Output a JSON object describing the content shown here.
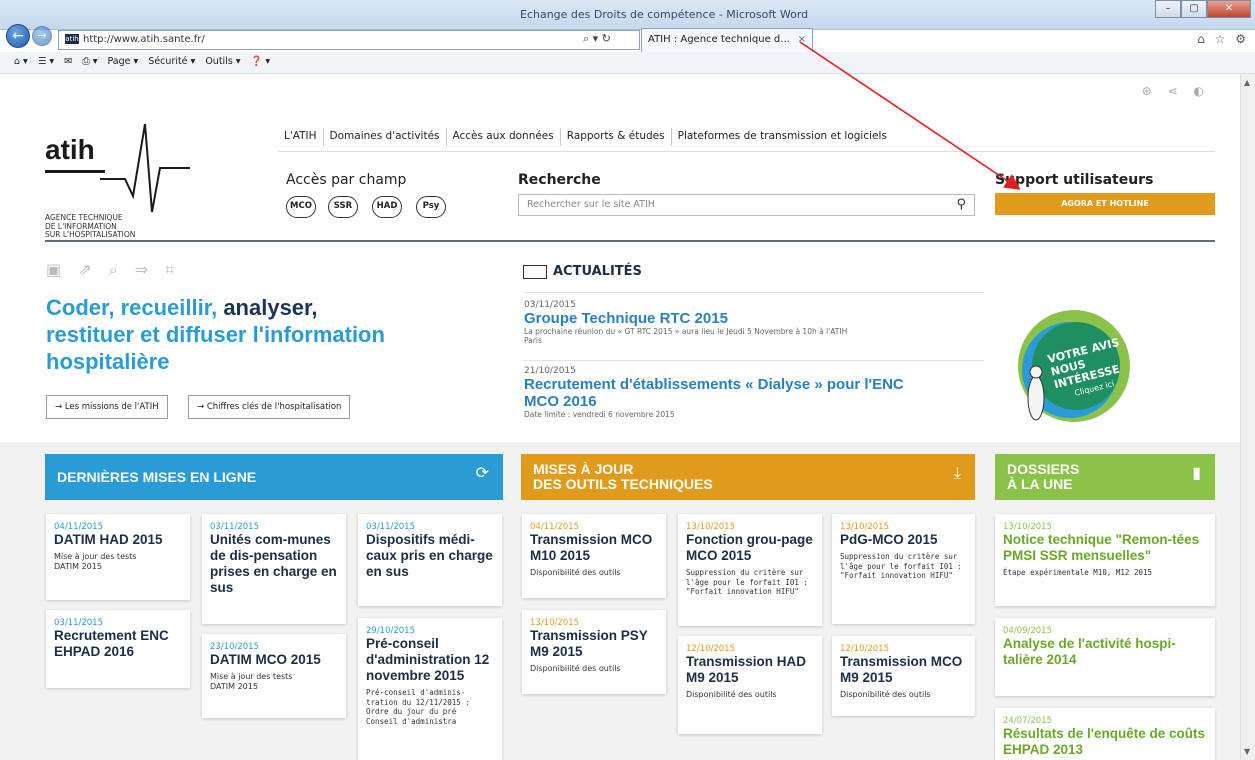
{
  "browser": {
    "window_title": "Echange des Droits de compétence - Microsoft Word",
    "back_glyph": "←",
    "forward_glyph": "→",
    "address": "http://www.atih.sante.fr/",
    "address_icon_text": "atih",
    "addr_tools": "⌕ ▾ ↻",
    "tab_label": "ATIH : Agence technique d...",
    "tab_close": "×",
    "right_icons": "⌂ ☆ ⚙",
    "win_min": "–",
    "win_max": "▢",
    "win_close": "✕",
    "cmd_items": [
      "⌂ ▾",
      "☰ ▾",
      "✉",
      "⎙ ▾",
      "Page ▾",
      "Sécurité ▾",
      "Outils ▾",
      "❓ ▾"
    ]
  },
  "site": {
    "top_icons": "⊛ ⋖ ◐",
    "logo_text": "atih",
    "logo_tagline": "AGENCE TECHNIQUE\nDE L'INFORMATION\nSUR L'HOSPITALISATION",
    "nav": [
      "L'ATIH",
      "Domaines d'activités",
      "Accès aux données",
      "Rapports & études",
      "Plateformes de transmission et logiciels"
    ],
    "acces_label": "Accès par champ",
    "champs": [
      "MCO",
      "SSR",
      "HAD",
      "Psy"
    ],
    "search_label": "Recherche",
    "search_placeholder": "Rechercher sur le site ATIH",
    "search_icon": "⚲",
    "support_label": "Support utilisateurs",
    "agora_button": "AGORA ET HOTLINE",
    "tool_icons": "▣ ⇗ ⌕ ⇒ ⌗",
    "hero_part1": "Coder, recueillir, ",
    "hero_part2": "analyser,",
    "hero_part3": "restituer et diffuser l'information hospitalière",
    "link_missions": "→  Les missions de l'ATIH",
    "link_chiffres": "→  Chiffres clés de l'hospitalisation",
    "news_heading": "ACTUALITÉS",
    "news": [
      {
        "date": "03/11/2015",
        "title": "Groupe Technique RTC 2015",
        "desc": "La prochaine réunion du « GT RTC 2015 » aura lieu le Jeudi 5 Novembre à 10h à l'ATIH\nParis"
      },
      {
        "date": "21/10/2015",
        "title": "Recrutement d'établissements « Dialyse » pour l'ENC MCO 2016",
        "desc": "Date limite : vendredi 6 novembre 2015"
      }
    ],
    "votre_avis": "VOTRE AVIS\nNOUS\nINTÉRESSE",
    "cliquez": "Cliquez ici"
  },
  "sections": {
    "derniere": {
      "title": "DERNIÈRES MISES EN LIGNE",
      "icon": "⟳",
      "color": "#2a9bd4"
    },
    "outils": {
      "title": "MISES À JOUR\nDES OUTILS TECHNIQUES",
      "icon": "⤓",
      "color": "#e09b1c"
    },
    "dossiers": {
      "title": "DOSSIERS\nÀ LA UNE",
      "icon": "▮",
      "color": "#8bc34a"
    }
  },
  "cards_blue": [
    {
      "date": "04/11/2015",
      "title": "DATIM HAD 2015",
      "sub": "Mise à jour des tests\nDATIM 2015"
    },
    {
      "date": "03/11/2015",
      "title": "Recrutement ENC EHPAD 2016",
      "sub": ""
    },
    {
      "date": "03/11/2015",
      "title": "Unités com-munes de dis-pensation prises en charge en sus",
      "sub": ""
    },
    {
      "date": "23/10/2015",
      "title": "DATIM MCO 2015",
      "sub": "Mise à jour des tests\nDATIM 2015"
    },
    {
      "date": "03/11/2015",
      "title": "Dispositifs médi-caux pris en charge en sus",
      "sub": ""
    },
    {
      "date": "29/10/2015",
      "title": "Pré-conseil d'administration 12 novembre 2015",
      "sub": "Pré-conseil d'adminis-tration du 12/11/2015 :\n Ordre du jour du pré\nConseil d'administra"
    }
  ],
  "cards_orange": [
    {
      "date": "04/11/2015",
      "title": "Transmission MCO M10 2015",
      "sub": "Disponibilité des outils"
    },
    {
      "date": "13/10/2015",
      "title": "Transmission PSY M9 2015",
      "sub": "Disponibilité des outils"
    },
    {
      "date": "13/10/2015",
      "title": "Fonction grou-page MCO 2015",
      "sub": "Suppression du critère sur l'âge pour le forfait I01 : \"Forfait innovation HIFU\""
    },
    {
      "date": "12/10/2015",
      "title": "Transmission HAD M9 2015",
      "sub": "Disponibilité des outils"
    },
    {
      "date": "13/10/2015",
      "title": "PdG-MCO 2015",
      "sub": "Suppression du critère sur l'âge pour le forfait I01 : \"Forfait innovation HIFU\""
    },
    {
      "date": "12/10/2015",
      "title": "Transmission MCO M9 2015",
      "sub": "Disponibilité des outils"
    }
  ],
  "cards_green": [
    {
      "date": "13/10/2015",
      "title": "Notice technique \"Remon-tées PMSI SSR mensuelles\"",
      "sub": "Étape expérimentale M10, M12 2015"
    },
    {
      "date": "04/09/2015",
      "title": "Analyse de l'activité hospi-talière 2014",
      "sub": ""
    },
    {
      "date": "24/07/2015",
      "title": "Résultats de l'enquête de coûts EHPAD 2013",
      "sub": ""
    }
  ],
  "annotation": {
    "arrow_color": "#e0201f"
  }
}
